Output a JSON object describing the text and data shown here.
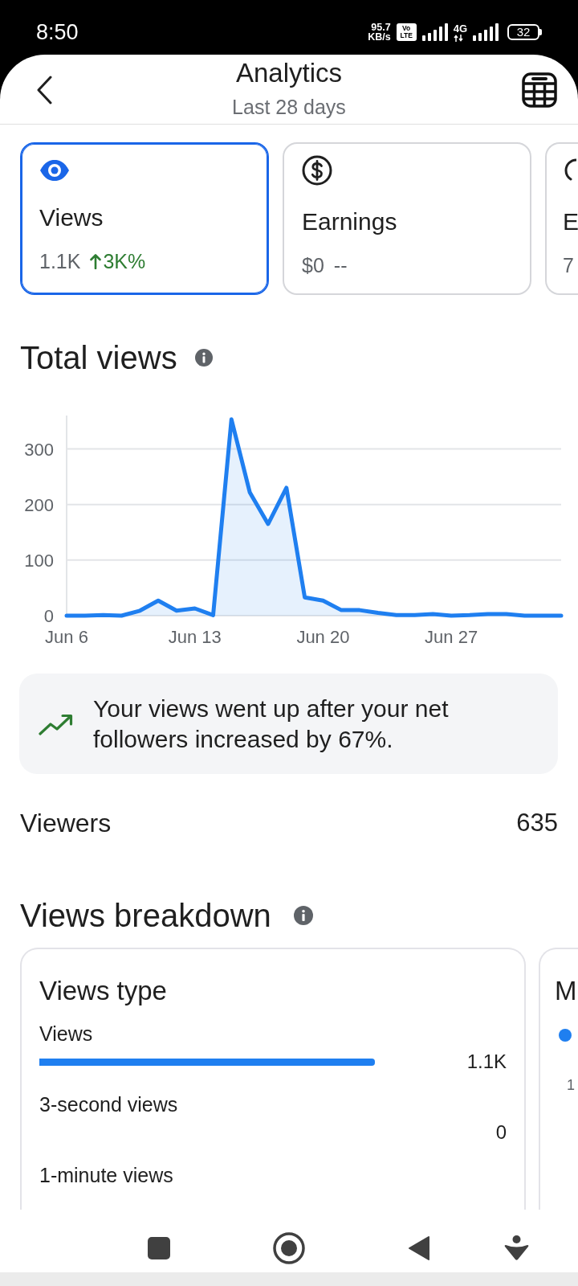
{
  "status_bar": {
    "time": "8:50",
    "speed": "95.7",
    "speed_unit": "KB/s",
    "volte": [
      "Vo",
      "LTE"
    ],
    "network": "4G",
    "battery": "32"
  },
  "header": {
    "title": "Analytics",
    "subtitle": "Last 28 days"
  },
  "metric_cards": [
    {
      "kind": "views",
      "label": "Views",
      "value": "1.1K",
      "change": "3K%",
      "rising": true,
      "selected": true
    },
    {
      "kind": "earnings",
      "label": "Earnings",
      "value": "$0",
      "change": "--",
      "rising": false,
      "selected": false
    },
    {
      "kind": "partial",
      "label": "E",
      "value": "7",
      "selected": false
    }
  ],
  "total_views": {
    "title": "Total views",
    "chart_data": {
      "type": "area",
      "categories": [
        "Jun 6",
        null,
        null,
        null,
        null,
        null,
        null,
        "Jun 13",
        null,
        null,
        null,
        null,
        null,
        null,
        "Jun 20",
        null,
        null,
        null,
        null,
        null,
        null,
        "Jun 27",
        null,
        null,
        null,
        null,
        null,
        null
      ],
      "series": [
        {
          "color": "#1f7ff0",
          "values": [
            0,
            0,
            1,
            0,
            9,
            27,
            9,
            13,
            1,
            353,
            222,
            165,
            230,
            33,
            27,
            10,
            10,
            5,
            1,
            1,
            3,
            0,
            1,
            3,
            3,
            0,
            0,
            0
          ]
        }
      ],
      "ylim": [
        0,
        360
      ],
      "yticks": [
        0,
        100,
        200,
        300
      ],
      "grid": true
    }
  },
  "insight": {
    "text": "Your views went up after your net followers increased by 67%."
  },
  "viewers": {
    "label": "Viewers",
    "value": "635"
  },
  "views_breakdown": {
    "title": "Views breakdown",
    "cards": [
      {
        "kind": "bars",
        "title": "Views type",
        "rows": [
          {
            "label": "Views",
            "value": "1.1K",
            "level": 1
          },
          {
            "label": "3-second views",
            "value": "0"
          },
          {
            "label": "1-minute views"
          }
        ]
      },
      {
        "kind": "partial",
        "title": "M",
        "axis_labels": [
          "1"
        ]
      }
    ]
  }
}
